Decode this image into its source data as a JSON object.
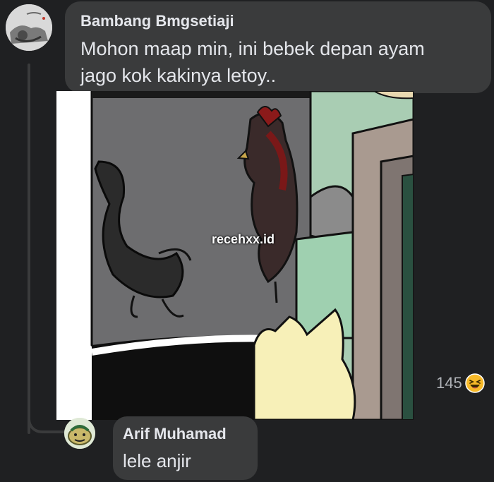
{
  "comment": {
    "author": "Bambang Bmgsetiaji",
    "text_line1": "Mohon maap min, ini bebek depan ayam",
    "text_line2": "jago kok kakinya letoy..",
    "avatar_icon": "profile-photo-avatar"
  },
  "image": {
    "watermark": "recehxx.id"
  },
  "reactions": {
    "count": "145",
    "icon": "laugh-emoji-icon"
  },
  "reply": {
    "author": "Arif Muhamad",
    "text": "lele anjir",
    "avatar_icon": "cartoon-avatar"
  },
  "colors": {
    "background": "#1f2022",
    "bubble": "#3a3b3c",
    "text": "#e4e6eb",
    "muted": "#b0b3b8",
    "laugh": "#f7b928"
  }
}
